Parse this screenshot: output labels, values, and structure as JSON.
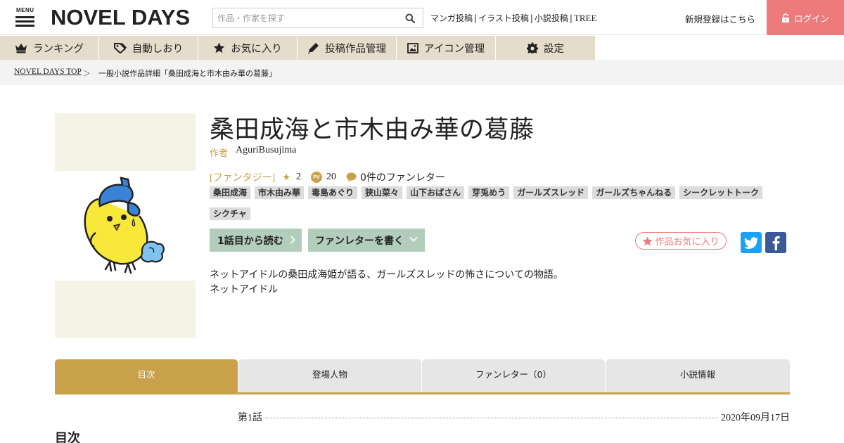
{
  "header": {
    "menu_label": "MENU",
    "logo_text": "NOVEL DAYS",
    "search_placeholder": "作品・作家を探す",
    "links": [
      {
        "label": "マンガ投稿"
      },
      {
        "label": "イラスト投稿"
      },
      {
        "label": "小説投稿"
      },
      {
        "label": "TREE"
      }
    ],
    "register_label": "新規登録はこちら",
    "login_label": "ログイン",
    "colors": {
      "login_bg": "#ee7b7b",
      "logo_accent": "#c0392b"
    }
  },
  "nav": {
    "items": [
      {
        "label": "ランキング",
        "icon": "crown-icon"
      },
      {
        "label": "自動しおり",
        "icon": "bookmark-tag-icon"
      },
      {
        "label": "お気に入り",
        "icon": "star-icon"
      },
      {
        "label": "投稿作品管理",
        "icon": "pen-icon"
      },
      {
        "label": "アイコン管理",
        "icon": "image-icon"
      },
      {
        "label": "設定",
        "icon": "gear-icon"
      }
    ],
    "color": "#e6dccb"
  },
  "breadcrumb": {
    "home": "NOVEL DAYS TOP",
    "separator": "＞",
    "current": "一般小説作品詳細「桑田成海と市木由み華の葛藤」"
  },
  "work": {
    "title": "桑田成海と市木由み華の葛藤",
    "author_label": "作者",
    "author": "AguriBusujima",
    "genre": "[ファンタジー]",
    "stars": "2",
    "pv_badge": "PV",
    "pv": "20",
    "fan_letters": "0件のファンレター",
    "tags": [
      "桑田成海",
      "市木由み華",
      "毒島あぐり",
      "狭山菜々",
      "山下おばさん",
      "芽兎めう",
      "ガールズスレッド",
      "ガールズちゃんねる",
      "シークレットトーク",
      "シクチャ"
    ],
    "read_first_label": "1話目から読む",
    "write_letter_label": "ファンレターを書く",
    "favorite_label": "作品お気に入り",
    "summary_lines": [
      "ネットアイドルの桑田成海姫が語る、ガールズスレッドの怖さについての物語。",
      "ネットアイドル"
    ],
    "accent_color": "#c9a14a"
  },
  "tabs": [
    {
      "label": "目次",
      "active": true
    },
    {
      "label": "登場人物",
      "active": false
    },
    {
      "label": "ファンレター（0）",
      "active": false
    },
    {
      "label": "小説情報",
      "active": false
    }
  ],
  "episodes": [
    {
      "title": "第1話",
      "date": "2020年09月17日"
    }
  ],
  "toc_heading": "目次"
}
